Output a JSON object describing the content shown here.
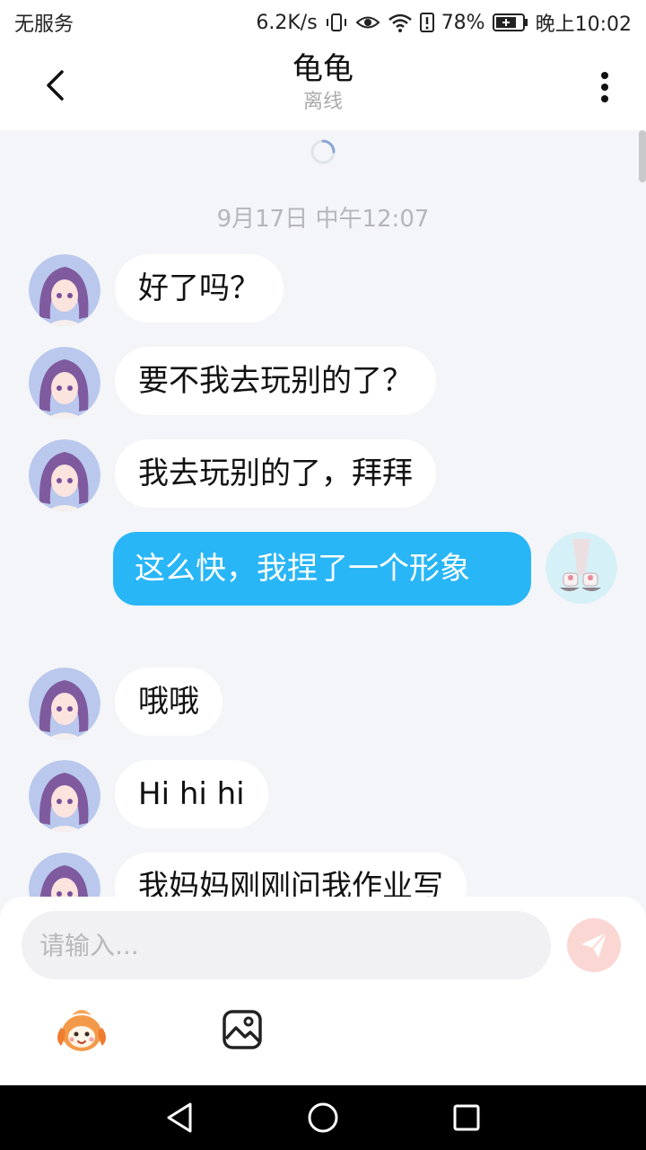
{
  "status_bar": {
    "carrier": "无服务",
    "speed": "6.2K/s",
    "battery": "78%",
    "time": "晚上10:02"
  },
  "header": {
    "title": "龟龟",
    "subtitle": "离线",
    "back_icon": "chevron-left-icon",
    "more_icon": "more-vertical-icon"
  },
  "chat": {
    "timestamp": "9月17日 中午12:07",
    "messages": [
      {
        "from": "other",
        "text": "好了吗？"
      },
      {
        "from": "other",
        "text": "要不我去玩别的了？"
      },
      {
        "from": "other",
        "text": "我去玩别的了，拜拜"
      },
      {
        "from": "me",
        "text": "这么快，我捏了一个形象"
      },
      {
        "from": "other",
        "text": "哦哦"
      },
      {
        "from": "other",
        "text": "Hi hi hi"
      },
      {
        "from": "other",
        "text": "我妈妈刚刚问我作业写"
      }
    ]
  },
  "composer": {
    "placeholder": "请输入...",
    "send_icon": "send-icon",
    "tools": [
      "emoji-mascot-icon",
      "image-icon"
    ]
  },
  "colors": {
    "my_bubble": "#29b6f6",
    "background": "#f4f5f8",
    "send_button": "#fbd7d4"
  }
}
